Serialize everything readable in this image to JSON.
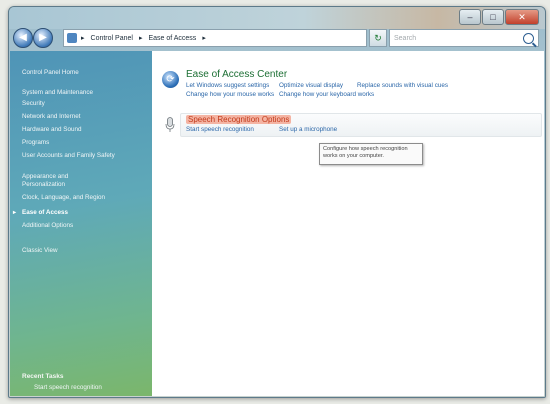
{
  "address_bar": {
    "segments": [
      "Control Panel",
      "Ease of Access"
    ]
  },
  "search": {
    "placeholder": "Search"
  },
  "sidebar": {
    "home": "Control Panel Home",
    "items": [
      "System and Maintenance",
      "Security",
      "Network and Internet",
      "Hardware and Sound",
      "Programs",
      "User Accounts and Family Safety",
      "Appearance and Personalization",
      "Clock, Language, and Region",
      "Ease of Access",
      "Additional Options"
    ],
    "classic_view": "Classic View",
    "recent_tasks_title": "Recent Tasks",
    "recent_task": "Start speech recognition"
  },
  "ease_of_access_center": {
    "title": "Ease of Access Center",
    "links": [
      "Let Windows suggest settings",
      "Optimize visual display",
      "Replace sounds with visual cues",
      "Change how your mouse works",
      "Change how your keyboard works"
    ]
  },
  "speech_recognition": {
    "title": "Speech Recognition Options",
    "links": [
      "Start speech recognition",
      "Set up a microphone"
    ]
  },
  "tooltip": {
    "text": "Configure how speech recognition works on your computer."
  },
  "window_buttons": {
    "minimize": "–",
    "maximize": "□",
    "close": "✕"
  }
}
